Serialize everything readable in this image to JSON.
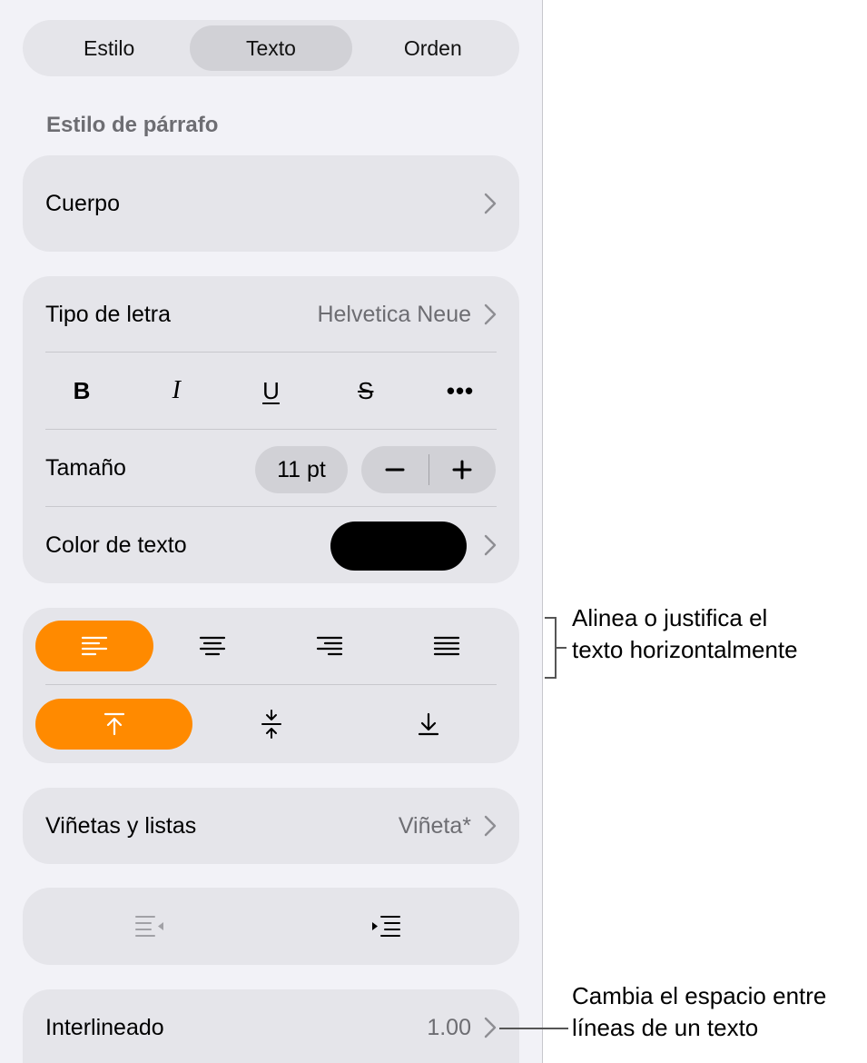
{
  "tabs": [
    {
      "label": "Estilo",
      "selected": false
    },
    {
      "label": "Texto",
      "selected": true
    },
    {
      "label": "Orden",
      "selected": false
    }
  ],
  "paragraph_style": {
    "title": "Estilo de párrafo",
    "value": "Cuerpo"
  },
  "font": {
    "label": "Tipo de letra",
    "value": "Helvetica Neue",
    "format_buttons": [
      "B",
      "I",
      "U",
      "S",
      "•••"
    ],
    "size_label": "Tamaño",
    "size_value": "11 pt",
    "color_label": "Color de texto",
    "color_value": "#000000"
  },
  "alignment": {
    "horizontal_selected": "left",
    "vertical_selected": "top",
    "accent_color": "#ff8a00"
  },
  "bullets": {
    "label": "Viñetas y listas",
    "value": "Viñeta*"
  },
  "line_spacing": {
    "label": "Interlineado",
    "value": "1.00"
  },
  "callouts": {
    "alignment": [
      "Alinea o justifica el",
      "texto horizontalmente"
    ],
    "spacing": [
      "Cambia el espacio entre",
      "líneas de un texto"
    ]
  }
}
